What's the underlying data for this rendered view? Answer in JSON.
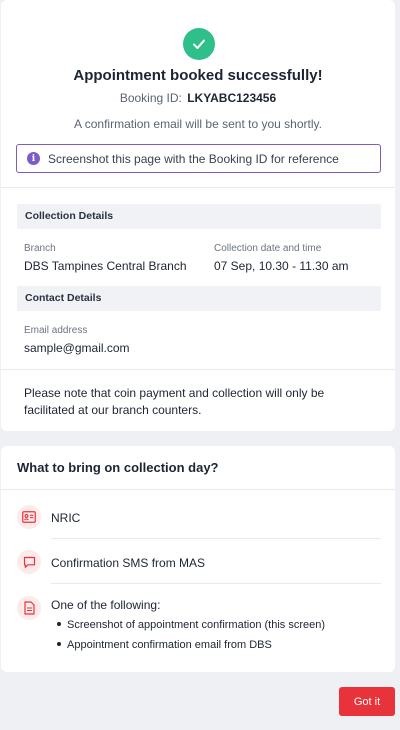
{
  "confirmation": {
    "title": "Appointment booked successfully!",
    "booking_id_label": "Booking ID:",
    "booking_id": "LKYABC123456",
    "email_note": "A confirmation email will be sent to you shortly.",
    "banner_text": "Screenshot this page with the Booking ID for reference",
    "banner_icon": "i"
  },
  "collection_details": {
    "header": "Collection Details",
    "branch_label": "Branch",
    "branch_value": "DBS Tampines Central Branch",
    "datetime_label": "Collection date and time",
    "datetime_value": "07 Sep, 10.30 - 11.30 am"
  },
  "contact_details": {
    "header": "Contact Details",
    "email_label": "Email address",
    "email_value": "sample@gmail.com"
  },
  "coin_note": "Please note that coin payment and collection will only be facilitated at our branch counters.",
  "bring": {
    "title": "What to bring on collection day?",
    "items": [
      {
        "icon": "id-card-icon",
        "label": "NRIC"
      },
      {
        "icon": "chat-bubble-icon",
        "label": "Confirmation SMS from MAS"
      },
      {
        "icon": "document-icon",
        "label": "One of the following:"
      }
    ],
    "sub_items": [
      "Screenshot of appointment confirmation (this screen)",
      "Appointment confirmation email from DBS"
    ]
  },
  "actions": {
    "got_it_label": "Got it"
  },
  "colors": {
    "success": "#2fbf8a",
    "info_accent": "#7b5cc9",
    "primary_button": "#e8333a",
    "icon_tint": "#e8333a"
  }
}
